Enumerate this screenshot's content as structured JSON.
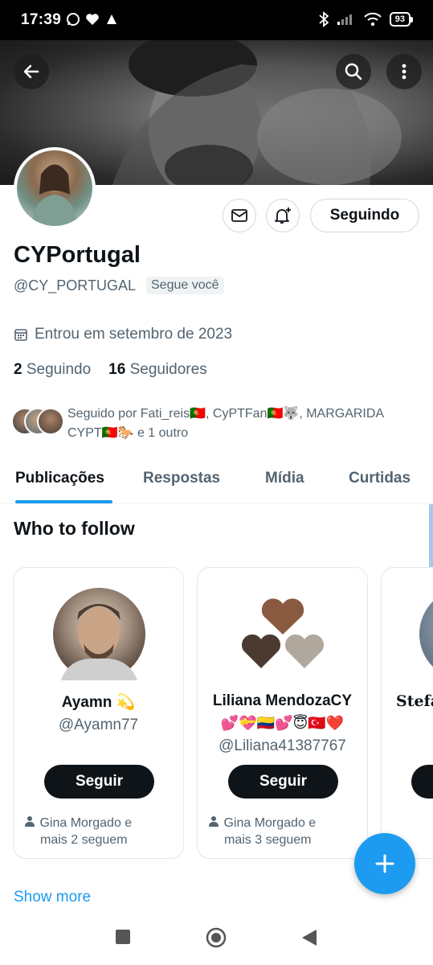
{
  "status_bar": {
    "time": "17:39",
    "battery": "93"
  },
  "profile": {
    "display_name": "CYPortugal",
    "handle": "@CY_PORTUGAL",
    "follows_you": "Segue você",
    "joined": "Entrou em setembro de 2023",
    "following_count": "2",
    "following_label": "Seguindo",
    "followers_count": "16",
    "followers_label": "Seguidores",
    "followed_by_line1": "Seguido por Fati_reis🇵🇹, CyPTFan🇵🇹🐺, MARGARIDA",
    "followed_by_line2": "CYPT🇵🇹🐎 e 1 outro"
  },
  "actions": {
    "following_button": "Seguindo"
  },
  "tabs": [
    {
      "label": "Publicações",
      "active": true
    },
    {
      "label": "Respostas",
      "active": false
    },
    {
      "label": "Mídia",
      "active": false
    },
    {
      "label": "Curtidas",
      "active": false
    }
  ],
  "who_to_follow": {
    "title": "Who to follow",
    "cards": [
      {
        "name": "Ayamn 💫",
        "emoji": "",
        "handle": "@Ayamn77",
        "button": "Seguir",
        "social_line1": "Gina Morgado e",
        "social_line2": "mais 2 seguem"
      },
      {
        "name": "Liliana MendozaCY",
        "emoji": "💕💝🇨🇴💕😇🇹🇷❤️",
        "handle": "@Liliana41387767",
        "button": "Seguir",
        "social_line1": "Gina Morgado e",
        "social_line2": "mais 3 seguem"
      },
      {
        "name": "Stefan"
      }
    ],
    "show_more": "Show more"
  },
  "colors": {
    "accent": "#1d9bf0",
    "text": "#0f1419",
    "muted": "#536471"
  }
}
